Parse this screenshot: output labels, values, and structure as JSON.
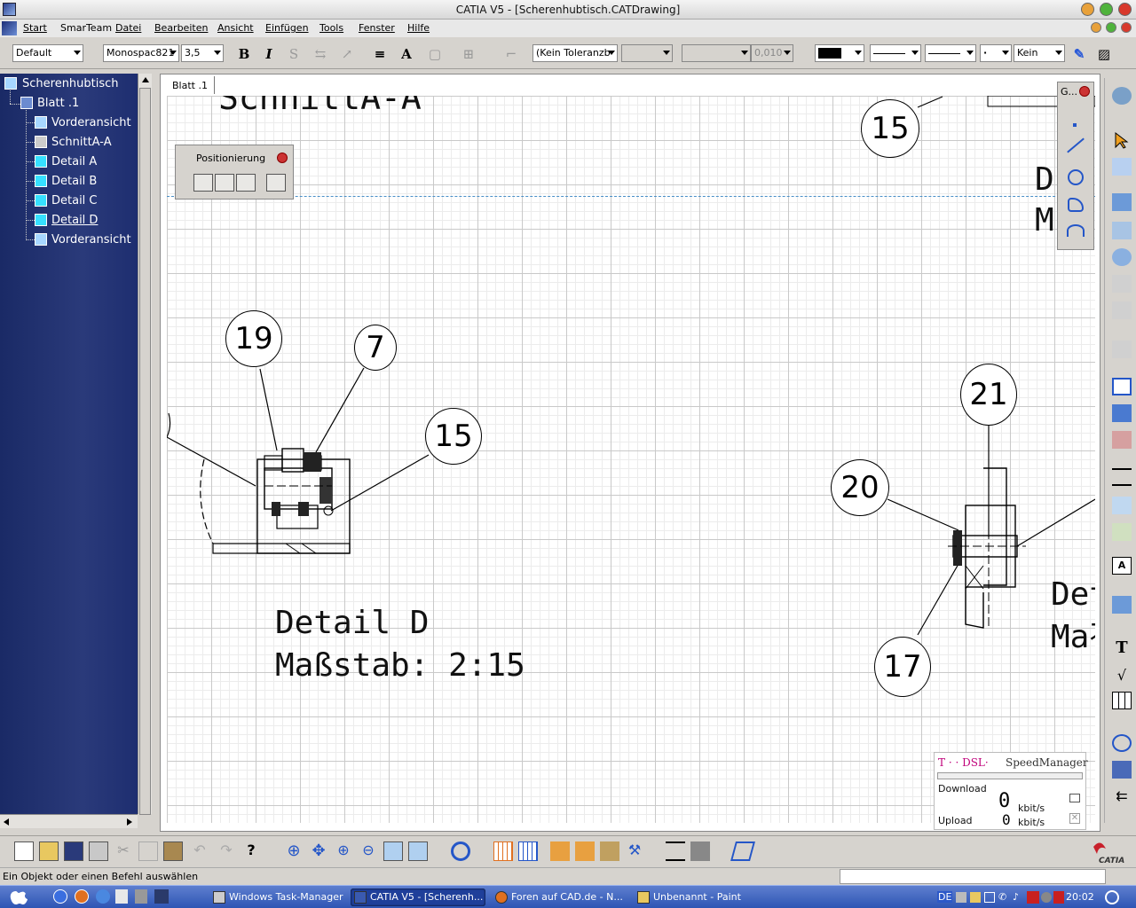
{
  "window": {
    "title": "CATIA V5 - [Scherenhubtisch.CATDrawing]"
  },
  "menu": {
    "items": [
      "Start",
      "SmarTeam",
      "Datei",
      "Bearbeiten",
      "Ansicht",
      "Einfügen",
      "Tools",
      "Fenster",
      "Hilfe"
    ]
  },
  "toolbar": {
    "style_select": "Default",
    "font_select": "Monospac821",
    "font_size_select": "3,5",
    "tolerance_select": "(Kein Toleranzb",
    "precision_select": "0,010",
    "pattern_select": "Kein"
  },
  "tree": {
    "root": "Scherenhubtisch",
    "sheet": "Blatt .1",
    "views": [
      "Vorderansicht",
      "SchnittA-A",
      "Detail A",
      "Detail B",
      "Detail C",
      "Detail D",
      "Vorderansicht"
    ],
    "selected_view_index": 5
  },
  "drawing": {
    "tab_label": "Blatt .1",
    "section_title_partial": "SchnittA-A",
    "detail_title": "Detail D",
    "detail_scale": "Maßstab:  2:15",
    "right_title_partial_1": "D",
    "right_title_partial_2": "M",
    "right_title2_partial_1": "Det",
    "right_title2_partial_2": "Mał",
    "balloons": [
      "15",
      "19",
      "7",
      "15",
      "21",
      "20",
      "17"
    ]
  },
  "positionierung_toolbar": {
    "title": "Positionierung"
  },
  "geometry_toolbar": {
    "title": "G..."
  },
  "speed_manager": {
    "brand": "T · · DSL·",
    "name": "SpeedManager",
    "download_label": "Download",
    "download_value": "0",
    "upload_label": "Upload",
    "upload_value": "0",
    "unit": "kbit/s"
  },
  "status_bar": {
    "text": "Ein Objekt oder einen Befehl auswählen"
  },
  "taskbar": {
    "tasks": [
      "Windows Task-Manager",
      "CATIA V5 - [Scherenh...",
      "Foren auf CAD.de - N...",
      "Unbenannt - Paint"
    ],
    "active_task_index": 1,
    "language": "DE",
    "clock": "20:02"
  },
  "branding": {
    "catia_logo_text": "CATIA"
  }
}
